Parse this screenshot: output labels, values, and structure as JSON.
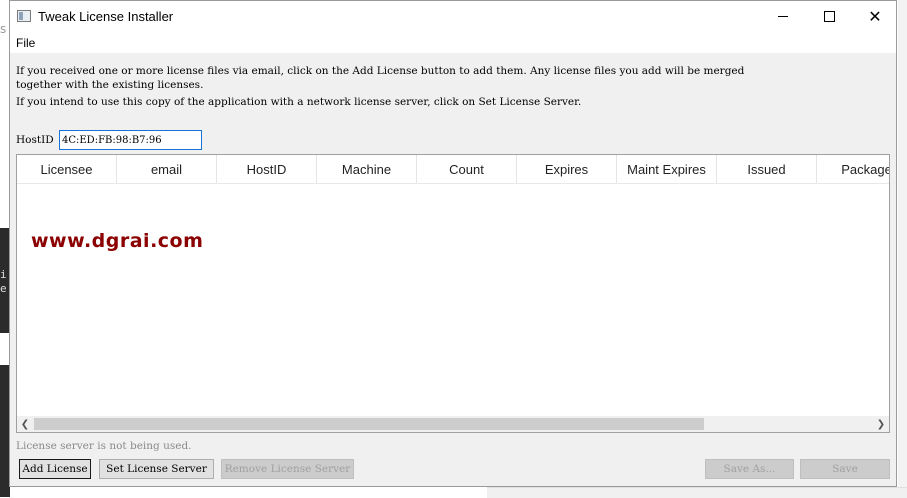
{
  "window": {
    "title": "Tweak License Installer"
  },
  "menu": {
    "file": "File"
  },
  "info": {
    "line1a": "If you received one or more license files via email, click on the Add License button to add them. Any license files you add will be merged",
    "line1b": "together with the existing licenses.",
    "line2": "If you intend to use this copy of the application with a network license server, click on Set License Server."
  },
  "hostid": {
    "label": "HostID",
    "value": "4C:ED:FB:98:B7:96"
  },
  "table": {
    "columns": [
      "Licensee",
      "email",
      "HostID",
      "Machine",
      "Count",
      "Expires",
      "Maint Expires",
      "Issued",
      "Package"
    ],
    "rows": []
  },
  "watermark": "www.dgrai.com",
  "status": "License server is not being used.",
  "buttons": {
    "add_license": "Add License",
    "set_license_server": "Set License Server",
    "remove_license_server": "Remove License Server",
    "save_as": "Save As...",
    "save": "Save"
  },
  "icons": {
    "app": "app-window-icon",
    "minimize": "minimize-icon",
    "maximize": "maximize-icon",
    "close": "close-icon",
    "scroll_left": "chevron-left-icon",
    "scroll_right": "chevron-right-icon"
  },
  "colors": {
    "focus_border": "#1a73d9",
    "watermark": "#8b0000"
  }
}
